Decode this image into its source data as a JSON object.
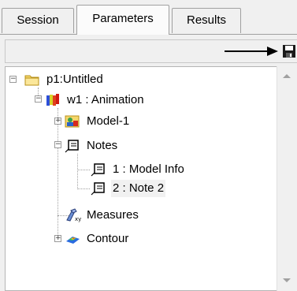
{
  "tabs": [
    {
      "label": "Session"
    },
    {
      "label": "Parameters"
    },
    {
      "label": "Results"
    }
  ],
  "tree": {
    "root": {
      "label": "p1:Untitled",
      "icon": "folder-icon"
    },
    "window": {
      "label": "w1 : Animation",
      "icon": "animation-icon"
    },
    "model": {
      "label": "Model-1",
      "icon": "model-icon"
    },
    "notes": {
      "label": "Notes",
      "icon": "note-icon"
    },
    "note1": {
      "label": "1 : Model Info",
      "icon": "note-icon"
    },
    "note2": {
      "label": "2 : Note 2",
      "icon": "note-icon"
    },
    "measures": {
      "label": "Measures",
      "icon": "measures-icon"
    },
    "contour": {
      "label": "Contour",
      "icon": "contour-icon"
    }
  },
  "expanders": {
    "collapse": "−",
    "expand": "+"
  },
  "colors": {
    "folder": "#f5d66b",
    "accent": "#000000"
  }
}
